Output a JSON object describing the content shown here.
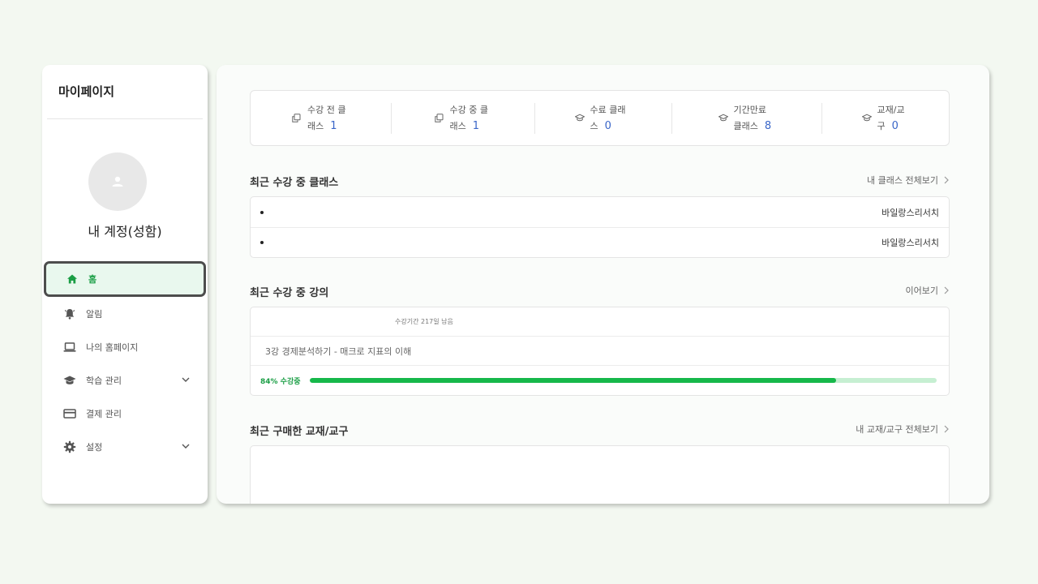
{
  "sidebar": {
    "title": "마이페이지",
    "account_name": "내 계정(성함)",
    "items": [
      {
        "label": "홈",
        "icon": "home-icon",
        "active": true
      },
      {
        "label": "알림",
        "icon": "bell-icon"
      },
      {
        "label": "나의 홈페이지",
        "icon": "laptop-icon"
      },
      {
        "label": "학습 관리",
        "icon": "graduation-cap-icon",
        "expandable": true
      },
      {
        "label": "결제 관리",
        "icon": "credit-card-icon"
      },
      {
        "label": "설정",
        "icon": "gear-icon",
        "expandable": true
      }
    ]
  },
  "stats": [
    {
      "label": "수강 전 클래스",
      "count": "1",
      "icon": "copy-icon"
    },
    {
      "label": "수강 중 클래스",
      "count": "1",
      "icon": "copy-icon"
    },
    {
      "label": "수료 클래스",
      "count": "0",
      "icon": "graduation-cap-icon"
    },
    {
      "label": "기간만료 클래스",
      "count": "8",
      "icon": "graduation-cap-icon"
    },
    {
      "label": "교재/교구",
      "count": "0",
      "icon": "graduation-cap-icon"
    }
  ],
  "recent_classes": {
    "title": "최근 수강 중 클래스",
    "link": "내 클래스 전체보기",
    "rows": [
      {
        "provider": "바일랑스리서치"
      },
      {
        "provider": "바일랑스리서치"
      }
    ]
  },
  "recent_lecture": {
    "title": "최근 수강 중 강의",
    "link": "이어보기",
    "period": "수강기간 217일 남음",
    "lecture_title": "3강 경제분석하기 - 매크로 지표의 이해",
    "progress_label": "84% 수강중",
    "progress_percent": 84
  },
  "recent_materials": {
    "title": "최근 구매한 교재/교구",
    "link": "내 교재/교구 전체보기"
  },
  "colors": {
    "accent": "#16b84a",
    "accent_light": "#c6efd2",
    "count_blue": "#3a66c8",
    "page_bg": "#f3f8f1"
  }
}
